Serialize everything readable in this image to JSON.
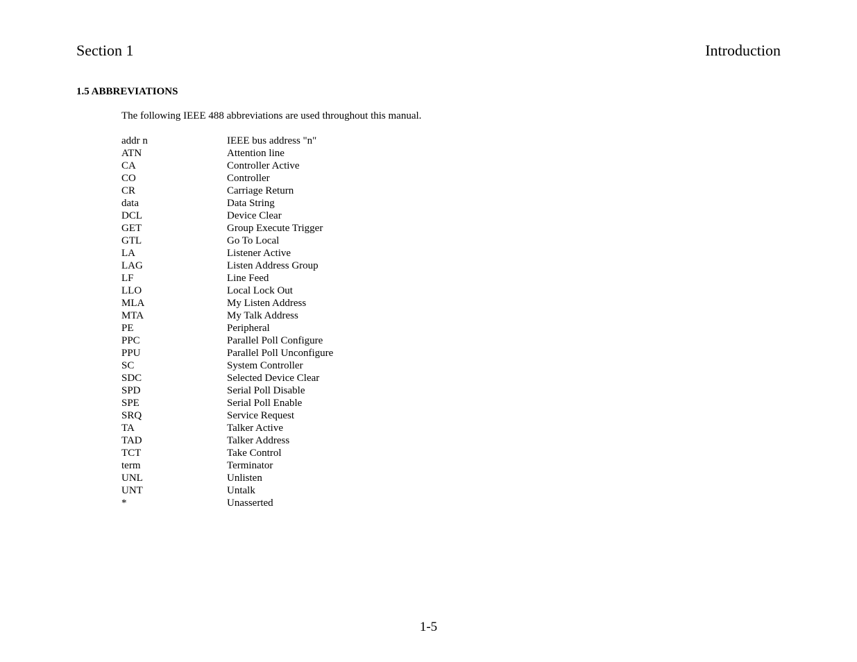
{
  "header": {
    "left": "Section 1",
    "right": "Introduction"
  },
  "section_heading": "1.5  ABBREVIATIONS",
  "intro_text": "The following IEEE 488 abbreviations are used throughout this manual.",
  "abbreviations": [
    {
      "key": "addr n",
      "val": "IEEE bus address \"n\""
    },
    {
      "key": "ATN",
      "val": "Attention line"
    },
    {
      "key": "CA",
      "val": "Controller Active"
    },
    {
      "key": "CO",
      "val": "Controller"
    },
    {
      "key": "CR",
      "val": "Carriage Return"
    },
    {
      "key": "data",
      "val": "Data String"
    },
    {
      "key": "DCL",
      "val": "Device Clear"
    },
    {
      "key": "GET",
      "val": "Group Execute Trigger"
    },
    {
      "key": "GTL",
      "val": "Go To Local"
    },
    {
      "key": "LA",
      "val": "Listener Active"
    },
    {
      "key": "LAG",
      "val": "Listen Address Group"
    },
    {
      "key": "LF",
      "val": "Line Feed"
    },
    {
      "key": "LLO",
      "val": "Local Lock Out"
    },
    {
      "key": "MLA",
      "val": "My Listen Address"
    },
    {
      "key": "MTA",
      "val": "My Talk Address"
    },
    {
      "key": "PE",
      "val": "Peripheral"
    },
    {
      "key": "PPC",
      "val": "Parallel Poll Configure"
    },
    {
      "key": "PPU",
      "val": "Parallel Poll Unconfigure"
    },
    {
      "key": "SC",
      "val": "System Controller"
    },
    {
      "key": "SDC",
      "val": "Selected Device Clear"
    },
    {
      "key": "SPD",
      "val": "Serial Poll Disable"
    },
    {
      "key": "SPE",
      "val": "Serial Poll Enable"
    },
    {
      "key": "SRQ",
      "val": "Service Request"
    },
    {
      "key": "TA",
      "val": "Talker Active"
    },
    {
      "key": "TAD",
      "val": "Talker Address"
    },
    {
      "key": "TCT",
      "val": "Take Control"
    },
    {
      "key": "term",
      "val": "Terminator"
    },
    {
      "key": "UNL",
      "val": "Unlisten"
    },
    {
      "key": "UNT",
      "val": "Untalk"
    },
    {
      "key": "*",
      "val": "Unasserted"
    }
  ],
  "page_number": "1-5"
}
